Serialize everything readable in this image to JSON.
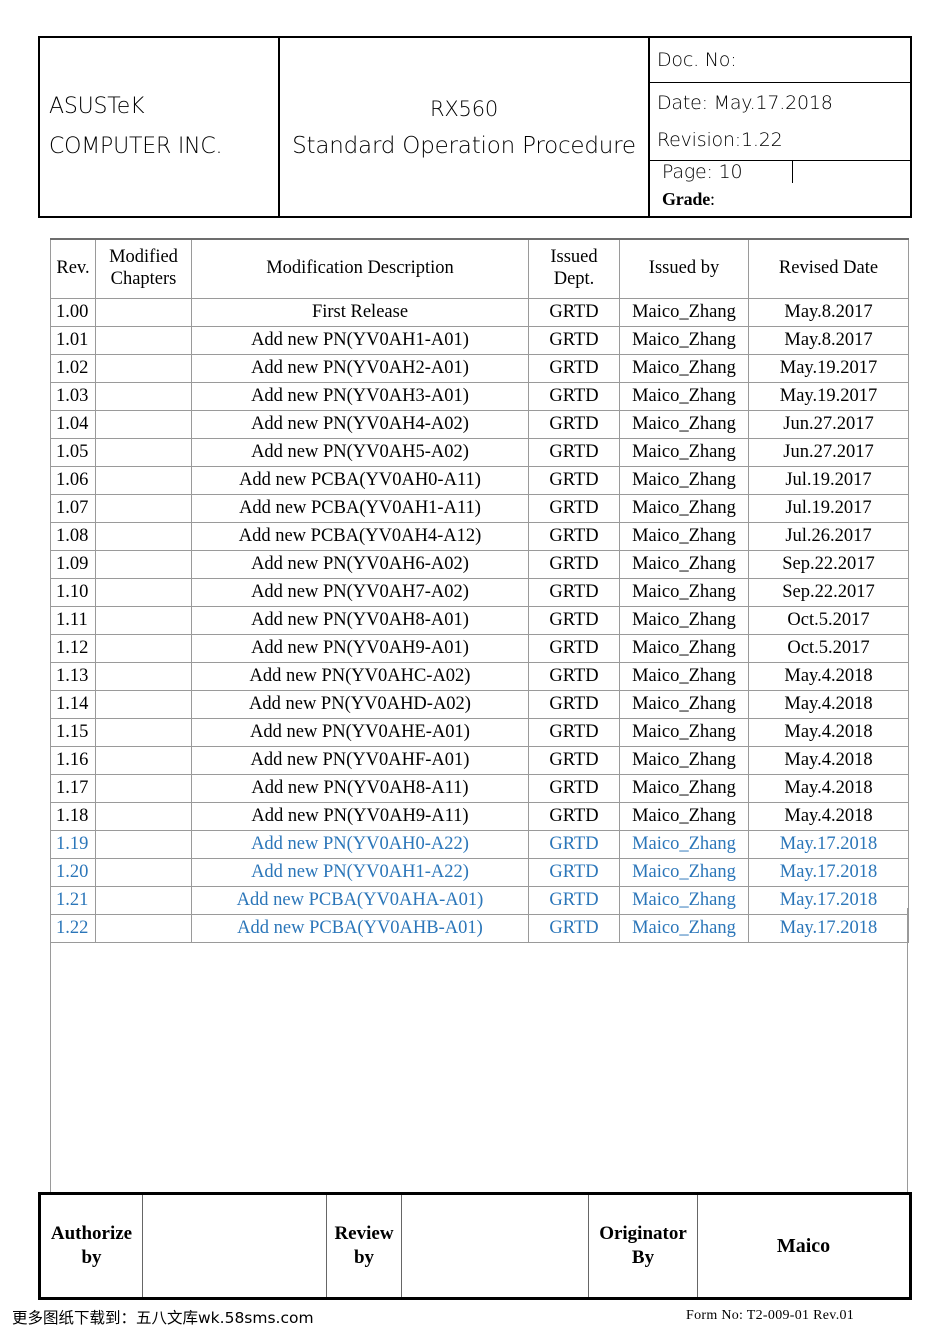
{
  "header": {
    "company_line1": "ASUSTeK",
    "company_line2": "COMPUTER INC.",
    "model": "RX560",
    "doc_title": "Standard Operation Procedure",
    "doc_no_label": "Doc. No:",
    "date_label": "Date: May.17.2018",
    "revision_label": "Revision:1.22",
    "page_label": "Page: 10",
    "grade_label": "Grade",
    "grade_colon": ":"
  },
  "revision_table": {
    "columns": [
      "Rev.",
      "Modified Chapters",
      "Modification Description",
      "Issued Dept.",
      "Issued by",
      "Revised Date"
    ],
    "columns_split": {
      "rev": "Rev.",
      "modified_chapters_l1": "Modified",
      "modified_chapters_l2": "Chapters",
      "modification_description": "Modification Description",
      "issued_dept_l1": "Issued",
      "issued_dept_l2": "Dept.",
      "issued_by": "Issued by",
      "revised_date": "Revised Date"
    },
    "highlight_color": "#2b76b9",
    "rows": [
      {
        "rev": "1.00",
        "chapters": "",
        "description": "First Release",
        "dept": "GRTD",
        "by": "Maico_Zhang",
        "date": "May.8.2017",
        "highlighted": false
      },
      {
        "rev": "1.01",
        "chapters": "",
        "description": "Add new PN(YV0AH1-A01)",
        "dept": "GRTD",
        "by": "Maico_Zhang",
        "date": "May.8.2017",
        "highlighted": false
      },
      {
        "rev": "1.02",
        "chapters": "",
        "description": "Add new PN(YV0AH2-A01)",
        "dept": "GRTD",
        "by": "Maico_Zhang",
        "date": "May.19.2017",
        "highlighted": false
      },
      {
        "rev": "1.03",
        "chapters": "",
        "description": "Add new PN(YV0AH3-A01)",
        "dept": "GRTD",
        "by": "Maico_Zhang",
        "date": "May.19.2017",
        "highlighted": false
      },
      {
        "rev": "1.04",
        "chapters": "",
        "description": "Add new PN(YV0AH4-A02)",
        "dept": "GRTD",
        "by": "Maico_Zhang",
        "date": "Jun.27.2017",
        "highlighted": false
      },
      {
        "rev": "1.05",
        "chapters": "",
        "description": "Add new PN(YV0AH5-A02)",
        "dept": "GRTD",
        "by": "Maico_Zhang",
        "date": "Jun.27.2017",
        "highlighted": false
      },
      {
        "rev": "1.06",
        "chapters": "",
        "description": "Add new PCBA(YV0AH0-A11)",
        "dept": "GRTD",
        "by": "Maico_Zhang",
        "date": "Jul.19.2017",
        "highlighted": false
      },
      {
        "rev": "1.07",
        "chapters": "",
        "description": "Add new PCBA(YV0AH1-A11)",
        "dept": "GRTD",
        "by": "Maico_Zhang",
        "date": "Jul.19.2017",
        "highlighted": false
      },
      {
        "rev": "1.08",
        "chapters": "",
        "description": "Add new PCBA(YV0AH4-A12)",
        "dept": "GRTD",
        "by": "Maico_Zhang",
        "date": "Jul.26.2017",
        "highlighted": false
      },
      {
        "rev": "1.09",
        "chapters": "",
        "description": "Add new PN(YV0AH6-A02)",
        "dept": "GRTD",
        "by": "Maico_Zhang",
        "date": "Sep.22.2017",
        "highlighted": false
      },
      {
        "rev": "1.10",
        "chapters": "",
        "description": "Add new PN(YV0AH7-A02)",
        "dept": "GRTD",
        "by": "Maico_Zhang",
        "date": "Sep.22.2017",
        "highlighted": false
      },
      {
        "rev": "1.11",
        "chapters": "",
        "description": "Add new PN(YV0AH8-A01)",
        "dept": "GRTD",
        "by": "Maico_Zhang",
        "date": "Oct.5.2017",
        "highlighted": false
      },
      {
        "rev": "1.12",
        "chapters": "",
        "description": "Add new PN(YV0AH9-A01)",
        "dept": "GRTD",
        "by": "Maico_Zhang",
        "date": "Oct.5.2017",
        "highlighted": false
      },
      {
        "rev": "1.13",
        "chapters": "",
        "description": "Add new PN(YV0AHC-A02)",
        "dept": "GRTD",
        "by": "Maico_Zhang",
        "date": "May.4.2018",
        "highlighted": false
      },
      {
        "rev": "1.14",
        "chapters": "",
        "description": "Add new PN(YV0AHD-A02)",
        "dept": "GRTD",
        "by": "Maico_Zhang",
        "date": "May.4.2018",
        "highlighted": false
      },
      {
        "rev": "1.15",
        "chapters": "",
        "description": "Add new PN(YV0AHE-A01)",
        "dept": "GRTD",
        "by": "Maico_Zhang",
        "date": "May.4.2018",
        "highlighted": false
      },
      {
        "rev": "1.16",
        "chapters": "",
        "description": "Add new PN(YV0AHF-A01)",
        "dept": "GRTD",
        "by": "Maico_Zhang",
        "date": "May.4.2018",
        "highlighted": false
      },
      {
        "rev": "1.17",
        "chapters": "",
        "description": "Add new PN(YV0AH8-A11)",
        "dept": "GRTD",
        "by": "Maico_Zhang",
        "date": "May.4.2018",
        "highlighted": false
      },
      {
        "rev": "1.18",
        "chapters": "",
        "description": "Add new PN(YV0AH9-A11)",
        "dept": "GRTD",
        "by": "Maico_Zhang",
        "date": "May.4.2018",
        "highlighted": false
      },
      {
        "rev": "1.19",
        "chapters": "",
        "description": "Add new PN(YV0AH0-A22)",
        "dept": "GRTD",
        "by": "Maico_Zhang",
        "date": "May.17.2018",
        "highlighted": true
      },
      {
        "rev": "1.20",
        "chapters": "",
        "description": "Add new PN(YV0AH1-A22)",
        "dept": "GRTD",
        "by": "Maico_Zhang",
        "date": "May.17.2018",
        "highlighted": true
      },
      {
        "rev": "1.21",
        "chapters": "",
        "description": "Add new PCBA(YV0AHA-A01)",
        "dept": "GRTD",
        "by": "Maico_Zhang",
        "date": "May.17.2018",
        "highlighted": true
      },
      {
        "rev": "1.22",
        "chapters": "",
        "description": "Add new PCBA(YV0AHB-A01)",
        "dept": "GRTD",
        "by": "Maico_Zhang",
        "date": "May.17.2018",
        "highlighted": true
      }
    ]
  },
  "signature_block": {
    "authorize_l1": "Authorize",
    "authorize_l2": "by",
    "authorize_value": "",
    "review_l1": "Review",
    "review_l2": "by",
    "review_value": "",
    "originator_l1": "Originator",
    "originator_l2": "By",
    "originator_value": "Maico"
  },
  "footer": {
    "left_text": "更多图纸下载到：五八文库wk.58sms.com",
    "right_text": "Form No: T2-009-01  Rev.01"
  }
}
